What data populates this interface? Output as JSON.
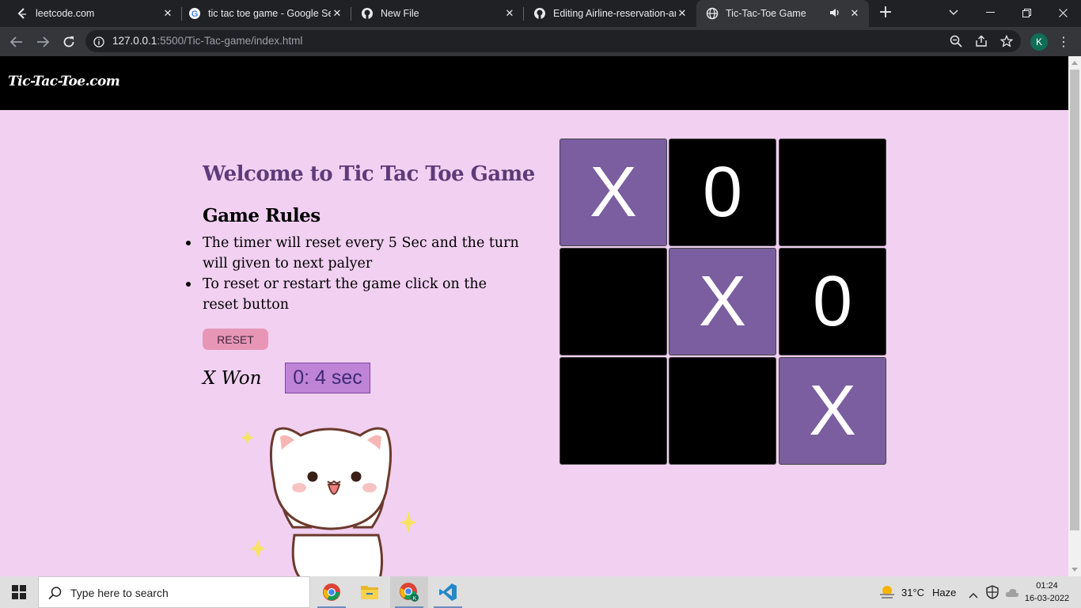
{
  "browser": {
    "tabs": [
      {
        "title": "leetcode.com",
        "icon": "leetcode-icon"
      },
      {
        "title": "tic tac toe game - Google Se",
        "icon": "google-icon"
      },
      {
        "title": "New File",
        "icon": "github-icon"
      },
      {
        "title": "Editing Airline-reservation-ar",
        "icon": "github-icon"
      },
      {
        "title": "Tic-Tac-Toe Game",
        "icon": "globe-icon",
        "active": true,
        "audio": true
      }
    ],
    "url_host": "127.0.0.1",
    "url_path": ":5500/Tic-Tac-game/index.html",
    "profile_initial": "K"
  },
  "page": {
    "brand": "Tic-Tac-Toe.com",
    "welcome": "Welcome to Tic Tac Toe Game",
    "rules_title": "Game Rules",
    "rules": [
      "The timer will reset every 5 Sec and the turn will given to next palyer",
      "To reset or restart the game click on the reset button"
    ],
    "reset_label": "RESET",
    "status": "X Won",
    "timer": "0: 4 sec",
    "board": [
      "X",
      "0",
      "",
      "",
      "X",
      "0",
      "",
      "",
      "X"
    ]
  },
  "colors": {
    "page_bg": "#f1d0f1",
    "x_cell": "#7a5e9f",
    "o_cell": "#000000",
    "welcome_text": "#5e3b78",
    "reset_bg": "#e896b6",
    "timer_bg": "#bf84d6"
  },
  "taskbar": {
    "search_placeholder": "Type here to search",
    "apps": [
      "chrome-icon",
      "file-explorer-icon",
      "chrome-profile-icon",
      "vscode-icon"
    ],
    "weather": "31°C",
    "weather_desc": "Haze",
    "time": "01:24",
    "date": "16-03-2022"
  }
}
